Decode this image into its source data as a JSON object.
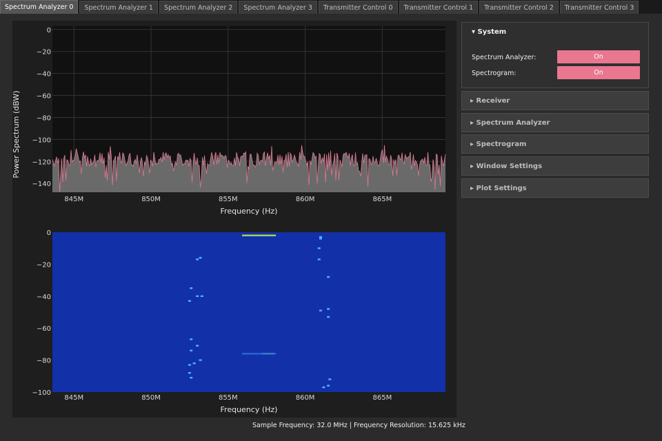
{
  "tabs": [
    {
      "label": "Spectrum Analyzer 0",
      "active": true
    },
    {
      "label": "Spectrum Analyzer 1",
      "active": false
    },
    {
      "label": "Spectrum Analyzer 2",
      "active": false
    },
    {
      "label": "Spectrum Analyzer 3",
      "active": false
    },
    {
      "label": "Transmitter Control 0",
      "active": false
    },
    {
      "label": "Transmitter Control 1",
      "active": false
    },
    {
      "label": "Transmitter Control 2",
      "active": false
    },
    {
      "label": "Transmitter Control 3",
      "active": false
    }
  ],
  "spectrum": {
    "ylabel": "Power Spectrum (dBW)",
    "xlabel": "Frequency (Hz)",
    "yticks": [
      "0",
      "−20",
      "−40",
      "−60",
      "−80",
      "−100",
      "−120",
      "−140"
    ],
    "xticks": [
      "845M",
      "850M",
      "855M",
      "860M",
      "865M"
    ],
    "trace_color": "#e07a92"
  },
  "spectrogram": {
    "xlabel": "Frequency (Hz)",
    "yticks": [
      "0",
      "−20",
      "−40",
      "−60",
      "−80",
      "−100"
    ],
    "xticks": [
      "845M",
      "850M",
      "855M",
      "860M",
      "865M"
    ],
    "background_color": "#1230a8"
  },
  "panel": {
    "system": {
      "title": "System",
      "rows": [
        {
          "label": "Spectrum Analyzer:",
          "value": "On"
        },
        {
          "label": "Spectrogram:",
          "value": "On"
        }
      ]
    },
    "sections": [
      "Receiver",
      "Spectrum Analyzer",
      "Spectrogram",
      "Window Settings",
      "Plot Settings"
    ],
    "expanded_icon": "triangle-down-icon",
    "collapsed_icon": "triangle-right-icon",
    "toggle_color": "#e8778f"
  },
  "status": "Sample Frequency: 32.0 MHz | Frequency Resolution: 15.625 kHz",
  "chart_data": [
    {
      "type": "line",
      "xlabel": "Frequency (Hz)",
      "ylabel": "Power Spectrum (dBW)",
      "xlim": [
        843600000,
        869100000
      ],
      "ylim": [
        -148,
        3
      ],
      "x_tick_labels": [
        "845M",
        "850M",
        "855M",
        "860M",
        "865M"
      ],
      "y_tick_labels": [
        "0",
        "−20",
        "−40",
        "−60",
        "−80",
        "−100",
        "−120",
        "−140"
      ],
      "grid": true,
      "series": [
        {
          "description_level": "noise floor",
          "mean_dBW": -120,
          "min_dBW": -147,
          "max_dBW": -108
        }
      ]
    },
    {
      "type": "heatmap",
      "xlabel": "Frequency (Hz)",
      "xlim": [
        843600000,
        869100000
      ],
      "ylim": [
        -100,
        0
      ],
      "x_tick_labels": [
        "845M",
        "850M",
        "855M",
        "860M",
        "865M"
      ],
      "y_tick_labels": [
        "0",
        "−20",
        "−40",
        "−60",
        "−80",
        "−100"
      ],
      "hot_spots": [
        {
          "x_hz": 857000000,
          "y": -2,
          "width_hz": 2200000,
          "color": "#b4f04a"
        },
        {
          "x_hz": 857600000,
          "y": -76,
          "width_hz": 800000,
          "color": "#b4f04a"
        },
        {
          "x_hz": 857000000,
          "y": -76,
          "width_hz": 2200000,
          "color": "#2a6ce0"
        }
      ]
    }
  ]
}
